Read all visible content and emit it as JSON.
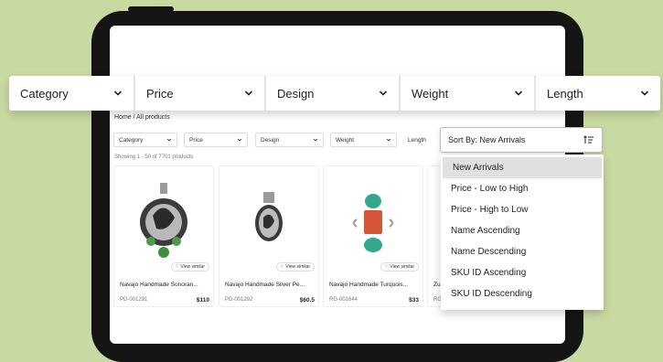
{
  "filter_bar": [
    {
      "label": "Category"
    },
    {
      "label": "Price"
    },
    {
      "label": "Design"
    },
    {
      "label": "Weight"
    },
    {
      "label": "Length"
    }
  ],
  "breadcrumb": "Home / All products",
  "mini_filters": [
    "Category",
    "Price",
    "Design",
    "Weight",
    "Length"
  ],
  "showing": "Showing 1 - 50 of 7701 products",
  "view_similar": "View similar",
  "products": [
    {
      "name": "Navajo Handmade Sonoran...",
      "sku": "PD-001291",
      "price": "$110"
    },
    {
      "name": "Navajo Handmade Silver Pe...",
      "sku": "PD-001292",
      "price": "$60.5"
    },
    {
      "name": "Navajo Handmade Turquois...",
      "sku": "RG-001644",
      "price": "$33"
    },
    {
      "name": "Zu",
      "sku": "RG"
    }
  ],
  "sort": {
    "label": "Sort By: New Arrivals",
    "options": [
      "New Arrivals",
      "Price - Low to High",
      "Price - High to Low",
      "Name Ascending",
      "Name Descending",
      "SKU ID Ascending",
      "SKU ID Descending"
    ],
    "selected": "New Arrivals"
  },
  "colors": {
    "background": "#c9d9a2",
    "device": "#151515"
  }
}
